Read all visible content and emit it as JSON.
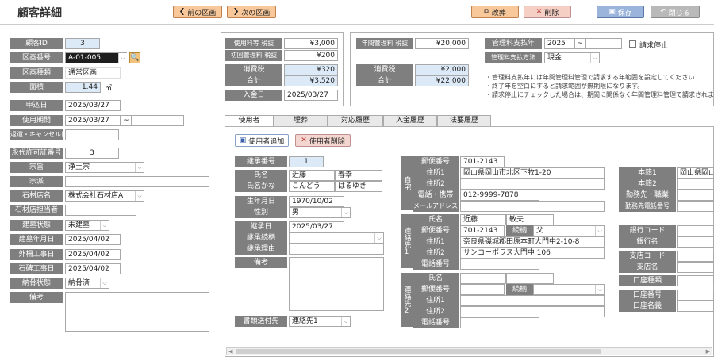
{
  "header": {
    "title": "顧客詳細",
    "prev": "前の区画",
    "next": "次の区画",
    "edit": "改葬",
    "delete": "削除",
    "save": "保存",
    "close": "閉じる"
  },
  "left": {
    "customer_id": {
      "label": "顧客ID",
      "value": "3"
    },
    "plot_no": {
      "label": "区画番号",
      "value": "A-01-005"
    },
    "plot_type": {
      "label": "区画種類",
      "value": "通常区画"
    },
    "area": {
      "label": "面積",
      "value": "1.44",
      "unit": "㎡"
    },
    "apply_date": {
      "label": "申込日",
      "value": "2025/03/27"
    },
    "use_period": {
      "label": "使用期間",
      "value": "2025/03/27",
      "sep": "~"
    },
    "return_cancel": {
      "label": "返還・キャンセル日",
      "value": ""
    },
    "permit_no": {
      "label": "永代許可証番号",
      "value": "3"
    },
    "sect": {
      "label": "宗旨",
      "value": "浄土宗"
    },
    "sect_school": {
      "label": "宗派",
      "value": ""
    },
    "stone_shop": {
      "label": "石材店名",
      "value": "株式会社石材店A"
    },
    "stone_staff": {
      "label": "石材店担当者",
      "value": ""
    },
    "construction": {
      "label": "建墓状態",
      "value": "未建墓"
    },
    "construct_date": {
      "label": "建墓年月日",
      "value": "2025/04/02"
    },
    "fence_date": {
      "label": "外柵工事日",
      "value": "2025/04/02"
    },
    "stone_date": {
      "label": "石碑工事日",
      "value": "2025/04/02"
    },
    "ossuary": {
      "label": "納骨状態",
      "value": "納骨済"
    },
    "remarks": {
      "label": "備考",
      "value": ""
    }
  },
  "fees": {
    "usage_fee": {
      "label": "使用料等 税抜",
      "value": "¥3,000"
    },
    "init_mgmt": {
      "label": "初回管理料 税抜",
      "value": "¥200"
    },
    "tax": {
      "label": "消費税",
      "value": "¥320"
    },
    "total": {
      "label": "合計",
      "value": "¥3,520"
    },
    "pay_date": {
      "label": "入金日",
      "value": "2025/03/27"
    }
  },
  "annual": {
    "fee": {
      "label": "年間管理料 税抜",
      "value": "¥20,000"
    },
    "tax": {
      "label": "消費税",
      "value": "¥2,000"
    },
    "total": {
      "label": "合計",
      "value": "¥22,000"
    },
    "pay_year": {
      "label": "管理料支払年",
      "value": "2025",
      "sep": "~"
    },
    "pay_method": {
      "label": "管理料支払方法",
      "value": "現金"
    },
    "stop_label": "請求停止",
    "notes": [
      "・管理料支払年には年間管理料管理で請求する年範囲を設定してください",
      "・終了年を空白にすると請求範囲が無期限になります。",
      "・請求停止にチェックした場合は、期間に関係なく年間管理料管理で請求されま"
    ]
  },
  "tabs": [
    "使用者",
    "埋葬",
    "対応履歴",
    "入金履歴",
    "法要履歴"
  ],
  "user_tab": {
    "add": "使用者追加",
    "remove": "使用者削除",
    "succession_no": {
      "label": "継承番号",
      "value": "1"
    },
    "name": {
      "label": "氏名",
      "last": "近藤",
      "first": "春幸"
    },
    "kana": {
      "label": "氏名かな",
      "last": "こんどう",
      "first": "はるゆき"
    },
    "birth": {
      "label": "生年月日",
      "value": "1970/10/02"
    },
    "gender": {
      "label": "性別",
      "value": "男"
    },
    "succ_date": {
      "label": "継承日",
      "value": "2025/03/27"
    },
    "succ_rel": {
      "label": "継承続柄",
      "value": ""
    },
    "succ_reason": {
      "label": "継承理由",
      "value": ""
    },
    "remarks": {
      "label": "備考",
      "value": ""
    },
    "doc_dest": {
      "label": "書類送付先",
      "value": "連絡先1"
    },
    "home": {
      "section": "自宅",
      "zip": {
        "label": "郵便番号",
        "value": "701-2143"
      },
      "addr1": {
        "label": "住所1",
        "value": "岡山県岡山市北区下牧1-20"
      },
      "addr2": {
        "label": "住所2",
        "value": ""
      },
      "tel": {
        "label": "電話・携帯",
        "value": "012-9999-7878"
      },
      "mail": {
        "label": "メールアドレス",
        "value": ""
      }
    },
    "contact1": {
      "section": "連絡先1",
      "name": {
        "label": "氏名",
        "last": "近藤",
        "first": "敏夫"
      },
      "zip": {
        "label": "郵便番号",
        "value": "701-2143"
      },
      "rel": {
        "label": "続柄",
        "value": "父"
      },
      "addr1": {
        "label": "住所1",
        "value": "奈良県磯城郡田原本町大門中2-10-8"
      },
      "addr2": {
        "label": "住所2",
        "value": "サンコーポラス大門中 106"
      },
      "tel": {
        "label": "電話番号",
        "value": ""
      }
    },
    "contact2": {
      "section": "連絡先2",
      "name": {
        "label": "氏名",
        "last": "",
        "first": ""
      },
      "zip": {
        "label": "郵便番号",
        "value": ""
      },
      "rel": {
        "label": "続柄",
        "value": ""
      },
      "addr1": {
        "label": "住所1",
        "value": ""
      },
      "addr2": {
        "label": "住所2",
        "value": ""
      },
      "tel": {
        "label": "電話番号",
        "value": ""
      }
    },
    "honseki1": {
      "label": "本籍1",
      "value": "岡山県岡山"
    },
    "honseki2": {
      "label": "本籍2",
      "value": ""
    },
    "work": {
      "label": "勤務先・職業",
      "value": ""
    },
    "work_tel": {
      "label": "勤務先電話番号",
      "value": ""
    },
    "bank_code": {
      "label": "銀行コード",
      "value": ""
    },
    "bank_name": {
      "label": "銀行名",
      "value": ""
    },
    "branch_code": {
      "label": "支店コード",
      "value": ""
    },
    "branch_name": {
      "label": "支店名",
      "value": ""
    },
    "acct_type": {
      "label": "口座種類",
      "value": ""
    },
    "acct_no": {
      "label": "口座番号",
      "value": ""
    },
    "acct_name": {
      "label": "口座名義",
      "value": ""
    }
  }
}
